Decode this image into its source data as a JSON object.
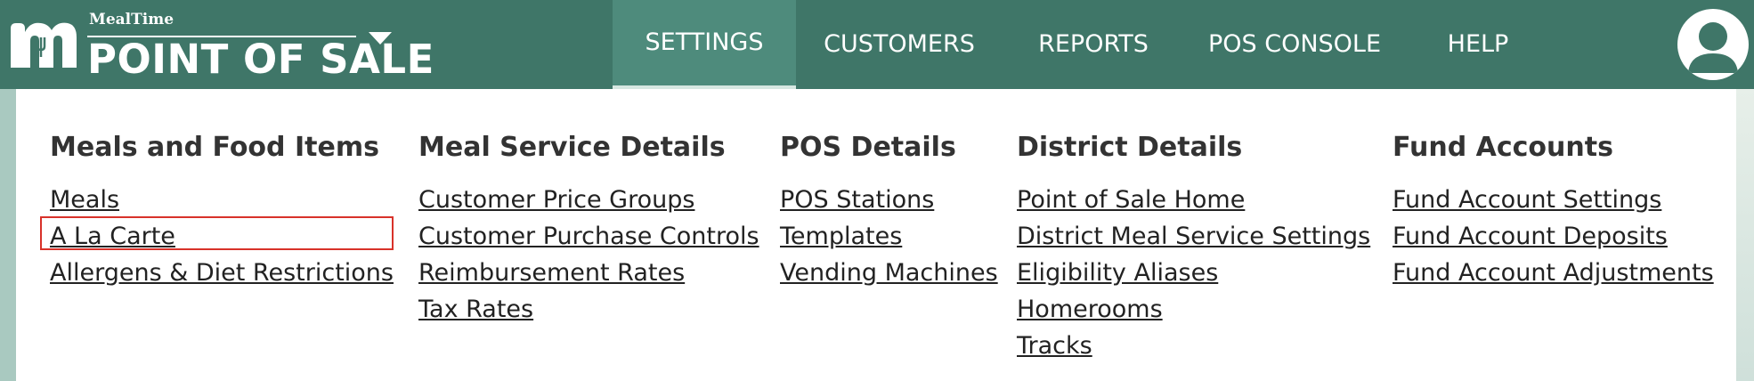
{
  "brand": {
    "small_title": "MealTime",
    "big_title": "POINT OF SALE",
    "colors": {
      "header": "#3f7668",
      "active_tab": "#4e8b7c",
      "highlight": "#d8322a"
    }
  },
  "nav": {
    "items": [
      {
        "label": "SETTINGS",
        "active": true
      },
      {
        "label": "CUSTOMERS"
      },
      {
        "label": "REPORTS"
      },
      {
        "label": "POS CONSOLE"
      },
      {
        "label": "HELP"
      }
    ]
  },
  "menu": {
    "columns": [
      {
        "heading": "Meals and Food Items",
        "links": [
          "Meals",
          "A La Carte",
          "Allergens & Diet Restrictions"
        ]
      },
      {
        "heading": "Meal Service Details",
        "links": [
          "Customer Price Groups",
          "Customer Purchase Controls",
          "Reimbursement Rates",
          "Tax Rates"
        ]
      },
      {
        "heading": "POS Details",
        "links": [
          "POS Stations",
          "Templates",
          "Vending Machines"
        ]
      },
      {
        "heading": "District Details",
        "links": [
          "Point of Sale Home",
          "District Meal Service Settings",
          "Eligibility Aliases",
          "Homerooms",
          "Tracks"
        ]
      },
      {
        "heading": "Fund Accounts",
        "links": [
          "Fund Account Settings",
          "Fund Account Deposits",
          "Fund Account Adjustments"
        ]
      }
    ],
    "highlighted_link": "A La Carte"
  },
  "icons": {
    "logo": "mealtime-m-logo",
    "caret": "chevron-down-icon",
    "user": "user-avatar-icon"
  }
}
